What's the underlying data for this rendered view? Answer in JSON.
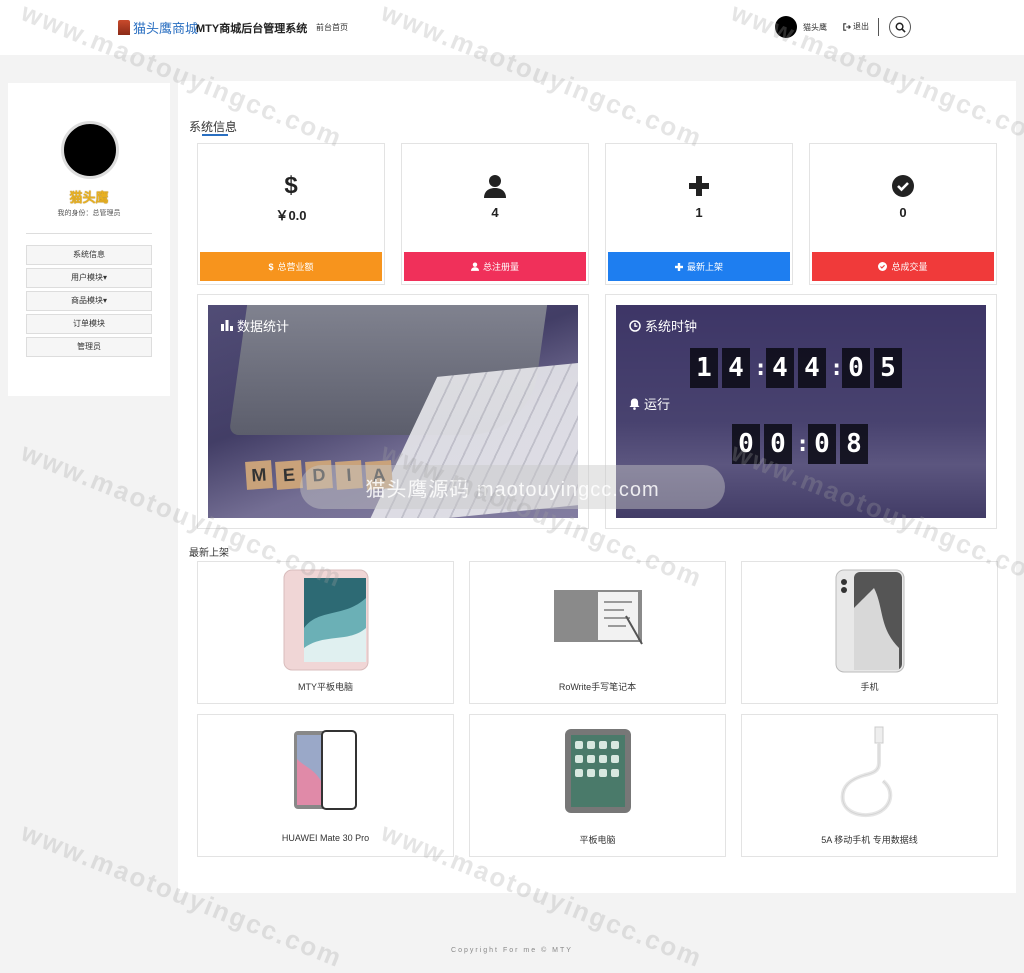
{
  "header": {
    "brand": "猫头鹰商城",
    "system_title": "MTY商城后台管理系统",
    "front_link": "前台首页",
    "username": "猫头鹰",
    "logout": "退出"
  },
  "sidebar": {
    "name": "猫头鹰",
    "role": "我的身份：总管理员",
    "items": [
      {
        "label": "系统信息"
      },
      {
        "label": "用户模块▾"
      },
      {
        "label": "商品模块▾"
      },
      {
        "label": "订单模块"
      },
      {
        "label": "管理员"
      }
    ]
  },
  "system_info": {
    "title": "系统信息",
    "cards": [
      {
        "value": "￥0.0",
        "label": "总营业额",
        "color": "#f7941d"
      },
      {
        "value": "4",
        "label": "总注册量",
        "color": "#f0305a"
      },
      {
        "value": "1",
        "label": "最新上架",
        "color": "#1e7ef0"
      },
      {
        "value": "0",
        "label": "总成交量",
        "color": "#f03a3a"
      }
    ]
  },
  "stats_panel": {
    "title": "数据统计",
    "tiles": [
      "M",
      "E",
      "D",
      "I",
      "A"
    ]
  },
  "clock_panel": {
    "title": "系统时钟",
    "time": [
      "1",
      "4",
      "4",
      "4",
      "0",
      "5"
    ],
    "run_label": "运行",
    "run": [
      "0",
      "0",
      "0",
      "8"
    ]
  },
  "overlay_watermark": "猫头鹰源码 maotouyingcc.com",
  "new_products": {
    "title": "最新上架",
    "items": [
      {
        "name": "MTY平板电脑"
      },
      {
        "name": "RoWrite手写笔记本"
      },
      {
        "name": "手机"
      },
      {
        "name": "HUAWEI Mate 30 Pro"
      },
      {
        "name": "平板电脑"
      },
      {
        "name": "5A 移动手机 专用数据线"
      }
    ]
  },
  "footer": "Copyright For me © MTY",
  "watermark": "www.maotouyingcc.com"
}
